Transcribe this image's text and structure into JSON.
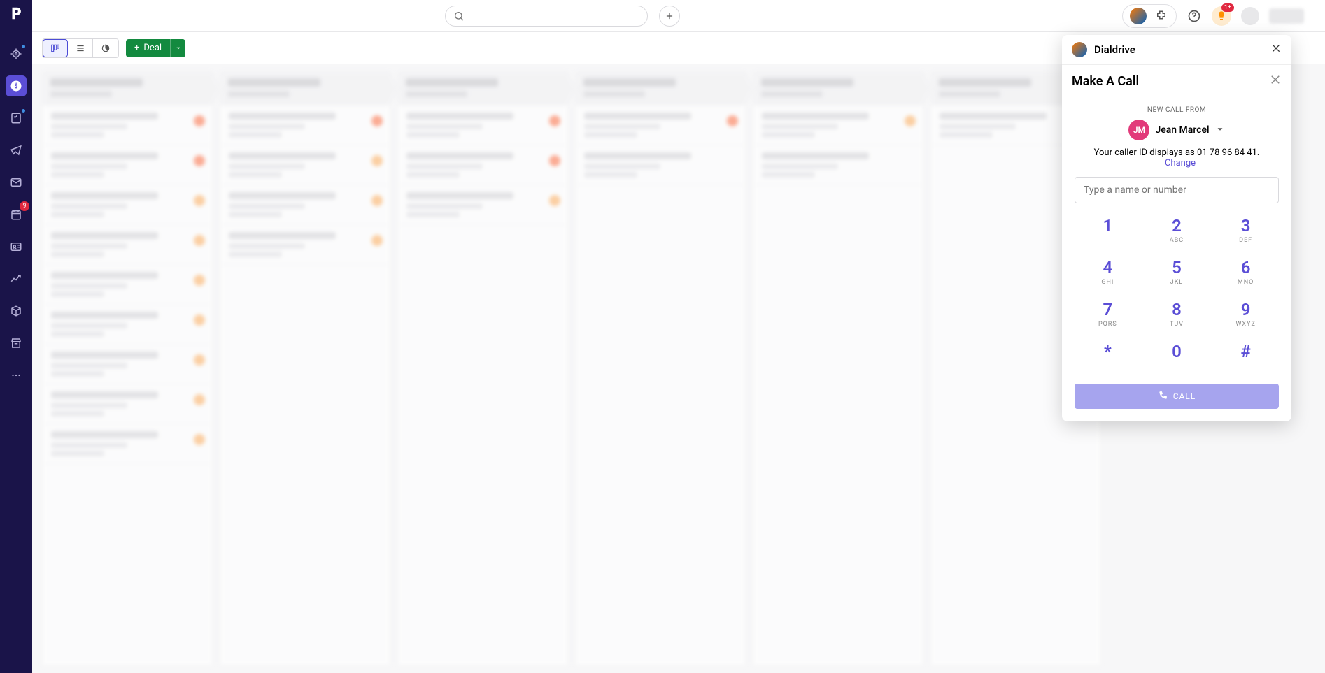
{
  "sidebar": {
    "activities_badge": "9"
  },
  "topbar": {
    "search_placeholder": "",
    "bulb_badge": "1+"
  },
  "toolbar": {
    "deal_label": "Deal"
  },
  "popover": {
    "brand": "Dialdrive",
    "title": "Make A Call",
    "new_call_from": "NEW CALL FROM",
    "caller_initials": "JM",
    "caller_name": "Jean Marcel",
    "caller_id_text": "Your caller ID displays as 01 78 96 84 41.",
    "change_label": "Change",
    "input_placeholder": "Type a name or number",
    "keys": [
      {
        "d": "1",
        "s": ""
      },
      {
        "d": "2",
        "s": "ABC"
      },
      {
        "d": "3",
        "s": "DEF"
      },
      {
        "d": "4",
        "s": "GHI"
      },
      {
        "d": "5",
        "s": "JKL"
      },
      {
        "d": "6",
        "s": "MNO"
      },
      {
        "d": "7",
        "s": "PQRS"
      },
      {
        "d": "8",
        "s": "TUV"
      },
      {
        "d": "9",
        "s": "WXYZ"
      },
      {
        "d": "*",
        "s": ""
      },
      {
        "d": "0",
        "s": ""
      },
      {
        "d": "#",
        "s": ""
      }
    ],
    "call_label": "CALL"
  }
}
